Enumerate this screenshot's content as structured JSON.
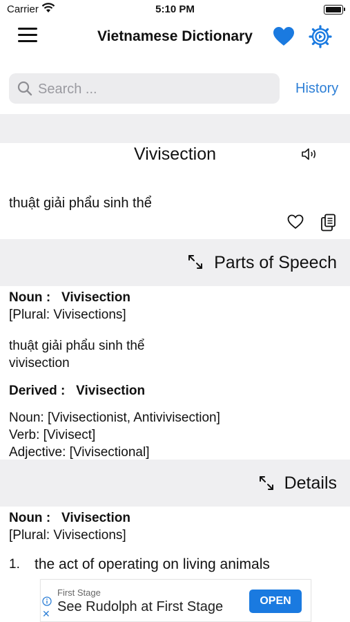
{
  "status_bar": {
    "carrier": "Carrier",
    "time": "5:10 PM"
  },
  "nav": {
    "title": "Vietnamese Dictionary",
    "icons": [
      "menu-icon",
      "heart-icon",
      "gear-icon"
    ]
  },
  "search": {
    "placeholder": "Search ...",
    "value": "",
    "history_label": "History"
  },
  "entry": {
    "word": "Vivisection",
    "translation": "thuật giải phẩu sinh thể"
  },
  "parts_of_speech": {
    "title": "Parts of Speech",
    "noun_label": "Noun :",
    "noun_word": "Vivisection",
    "plural": "[Plural: Vivisections]",
    "meaning_vi": "thuật giải phẩu sinh thể",
    "meaning_en": "vivisection",
    "derived_label": "Derived :",
    "derived_word": "Vivisection",
    "derived_noun": "Noun:  [Vivisectionist, Antivivisection]",
    "derived_verb": "Verb:  [Vivisect]",
    "derived_adj": "Adjective:  [Vivisectional]"
  },
  "details": {
    "title": "Details",
    "noun_label": "Noun :",
    "noun_word": "Vivisection",
    "plural": "[Plural: Vivisections]",
    "items": [
      {
        "num": "1.",
        "text": "the act of operating on living animals"
      }
    ]
  },
  "ad": {
    "sponsor": "First Stage",
    "headline": "See Rudolph at First Stage",
    "button": "OPEN"
  },
  "colors": {
    "accent": "#2d7fd6",
    "band": "#efeff1",
    "ad_button": "#1a7ae0"
  }
}
